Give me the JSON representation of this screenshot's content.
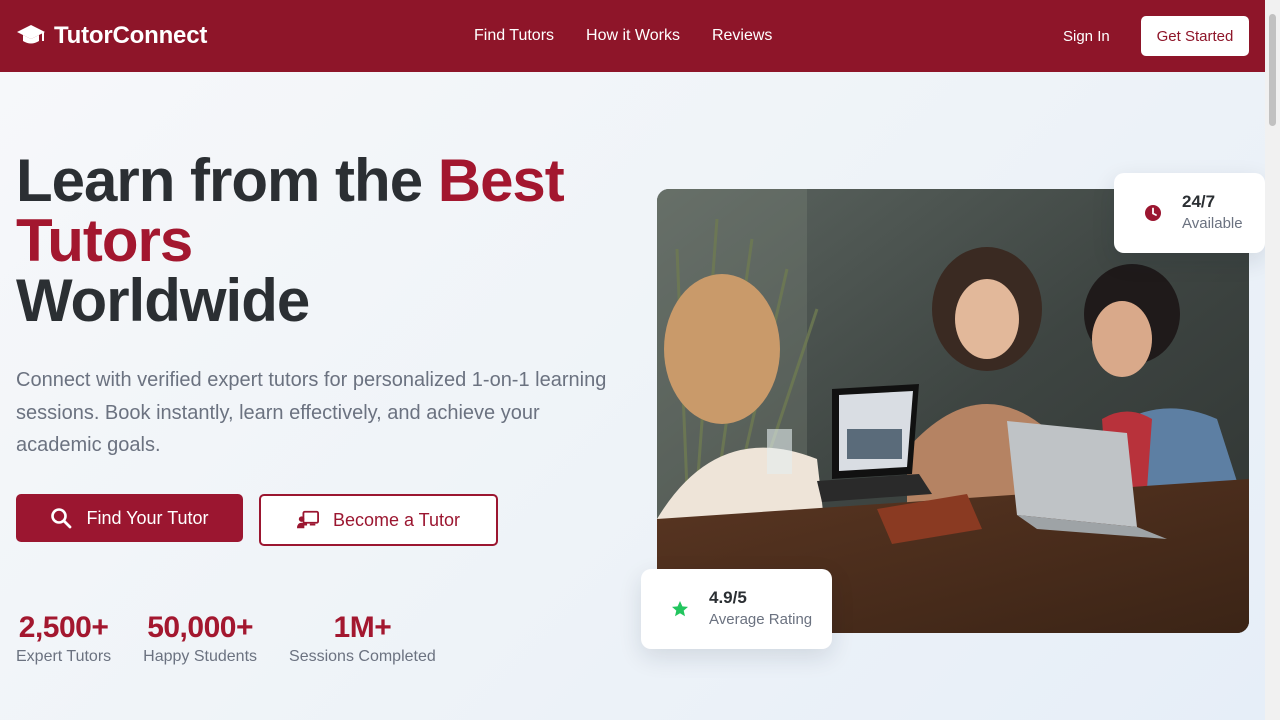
{
  "header": {
    "brand": "TutorConnect",
    "nav": [
      "Find Tutors",
      "How it Works",
      "Reviews"
    ],
    "sign_in": "Sign In",
    "get_started": "Get Started"
  },
  "hero": {
    "title_part1": "Learn from the ",
    "title_accent": "Best Tutors",
    "title_part2": "Worldwide",
    "subtitle": "Connect with verified expert tutors for personalized 1-on-1 learning sessions. Book instantly, learn effectively, and achieve your academic goals.",
    "primary_button": "Find Your Tutor",
    "secondary_button": "Become a Tutor"
  },
  "stats": [
    {
      "value": "2,500+",
      "label": "Expert Tutors"
    },
    {
      "value": "50,000+",
      "label": "Happy Students"
    },
    {
      "value": "1M+",
      "label": "Sessions Completed"
    }
  ],
  "cards": {
    "availability": {
      "value": "24/7",
      "label": "Available",
      "icon": "clock-icon"
    },
    "rating": {
      "value": "4.9/5",
      "label": "Average Rating",
      "icon": "star-icon"
    }
  },
  "colors": {
    "brand": "#8e1529",
    "accent": "#a3172f",
    "rating_star": "#22c55e"
  }
}
